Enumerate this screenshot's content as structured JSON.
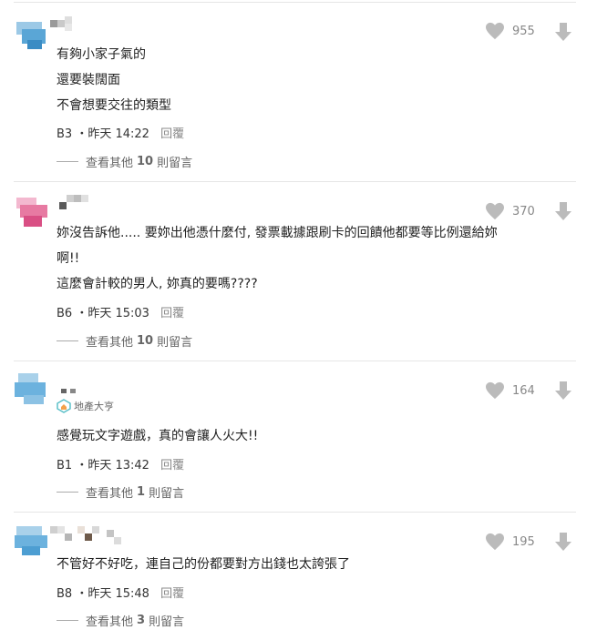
{
  "comments": [
    {
      "lines": [
        "有夠小家子氣的",
        "還要裝闊面",
        "不會想要交往的類型"
      ],
      "floor": "B3",
      "time": "昨天 14:22",
      "reply": "回覆",
      "likes": "955",
      "more_prefix": "查看其他",
      "more_count": "10",
      "more_suffix": "則留言"
    },
    {
      "lines": [
        "妳沒告訴他..... 要妳出他憑什麼付, 發票載據跟刷卡的回饋他都要等比例還給妳",
        "啊!!",
        "這麼會計較的男人, 妳真的要嗎????"
      ],
      "floor": "B6",
      "time": "昨天 15:03",
      "reply": "回覆",
      "likes": "370",
      "more_prefix": "查看其他",
      "more_count": "10",
      "more_suffix": "則留言"
    },
    {
      "badge": "地產大亨",
      "lines": [
        "感覺玩文字遊戲，真的會讓人火大!!"
      ],
      "floor": "B1",
      "time": "昨天 13:42",
      "reply": "回覆",
      "likes": "164",
      "more_prefix": "查看其他",
      "more_count": "1",
      "more_suffix": "則留言"
    },
    {
      "lines": [
        "不管好不好吃，連自己的份都要對方出錢也太誇張了"
      ],
      "floor": "B8",
      "time": "昨天 15:48",
      "reply": "回覆",
      "likes": "195",
      "more_prefix": "查看其他",
      "more_count": "3",
      "more_suffix": "則留言"
    }
  ],
  "icons": {
    "like": "heart-icon",
    "dislike": "down-arrow-icon",
    "badge": "house-badge-icon"
  },
  "colors": {
    "icon_gray": "#bbbbbb",
    "badge_teal": "#5bc0c8"
  }
}
